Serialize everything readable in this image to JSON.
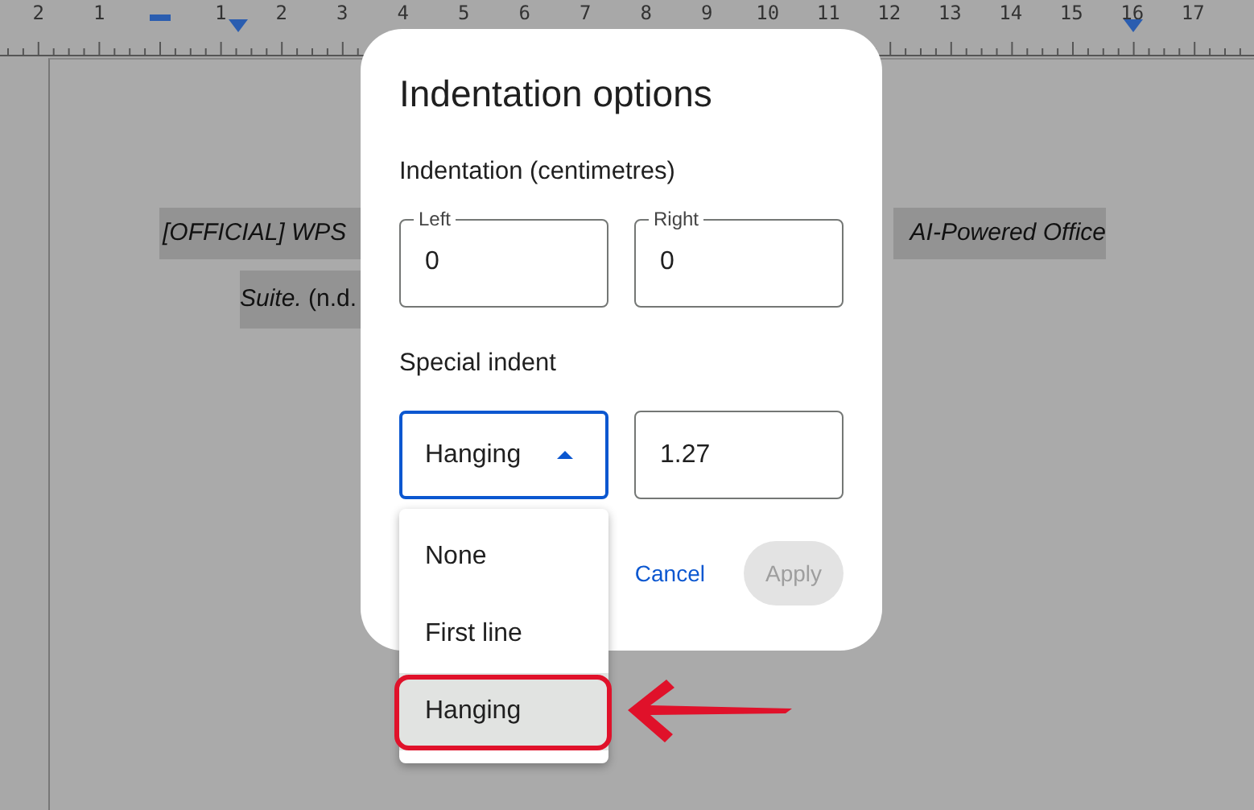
{
  "ruler": {
    "labels": [
      "2",
      "1",
      "1",
      "2",
      "3",
      "4",
      "5",
      "6",
      "7",
      "8",
      "9",
      "10",
      "11",
      "12",
      "13",
      "14",
      "15",
      "16",
      "17"
    ]
  },
  "document": {
    "lines": [
      {
        "segments": [
          "*[OFFICIAL] WPS*",
          "*AI-Powered Office*"
        ]
      },
      {
        "segments": [
          "*Suite.* (n.d."
        ]
      }
    ]
  },
  "dialog": {
    "title": "Indentation options",
    "section_title": "Indentation (centimetres)",
    "fields": [
      {
        "label": "Left",
        "value": "0"
      },
      {
        "label": "Right",
        "value": "0"
      }
    ],
    "special_title": "Special indent",
    "special_select": {
      "value": "Hanging",
      "expanded": true
    },
    "special_value": "1.27",
    "buttons": [
      {
        "label": "Cancel",
        "kind": "text",
        "disabled": false
      },
      {
        "label": "Apply",
        "kind": "filled",
        "disabled": true
      }
    ]
  },
  "menu": {
    "options": [
      {
        "label": "None",
        "selected": false
      },
      {
        "label": "First line",
        "selected": false
      },
      {
        "label": "Hanging",
        "selected": true
      }
    ]
  }
}
